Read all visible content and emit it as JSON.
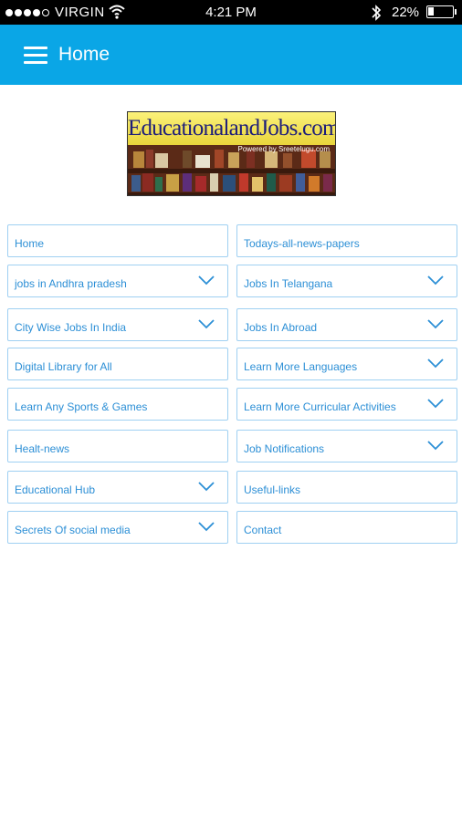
{
  "status_bar": {
    "carrier": "VIRGIN",
    "time": "4:21 PM",
    "battery": "22%",
    "battery_level": 0.22,
    "signal_icon": "signal-dots-icon",
    "wifi_icon": "wifi-icon",
    "bluetooth_icon": "bluetooth-icon"
  },
  "app_bar": {
    "title": "Home",
    "menu_icon": "hamburger-menu-icon",
    "background": "#0aa6e6"
  },
  "logo": {
    "text": "EducationalandJobs.com",
    "powered_by": "Powered by Sreetelugu.com"
  },
  "nav": {
    "accent": "#2c8fd6",
    "border": "#9fd0f2",
    "items": [
      {
        "label": "Home",
        "dropdown": false
      },
      {
        "label": "Todays-all-news-papers",
        "dropdown": false
      },
      {
        "label": "jobs in Andhra pradesh",
        "dropdown": true
      },
      {
        "label": "Jobs In Telangana",
        "dropdown": true
      },
      {
        "label": "City Wise  Jobs In India",
        "dropdown": true
      },
      {
        "label": "Jobs In Abroad",
        "dropdown": true
      },
      {
        "label": "Digital Library for All",
        "dropdown": false
      },
      {
        "label": "Learn More Languages",
        "dropdown": true
      },
      {
        "label": "Learn Any  Sports & Games",
        "dropdown": false
      },
      {
        "label": "Learn More Curricular Activities",
        "dropdown": true
      },
      {
        "label": "Healt-news",
        "dropdown": false
      },
      {
        "label": "Job Notifications",
        "dropdown": true
      },
      {
        "label": "Educational Hub",
        "dropdown": true
      },
      {
        "label": "Useful-links",
        "dropdown": false
      },
      {
        "label": "Secrets Of social media",
        "dropdown": true
      },
      {
        "label": "Contact",
        "dropdown": false
      }
    ]
  }
}
